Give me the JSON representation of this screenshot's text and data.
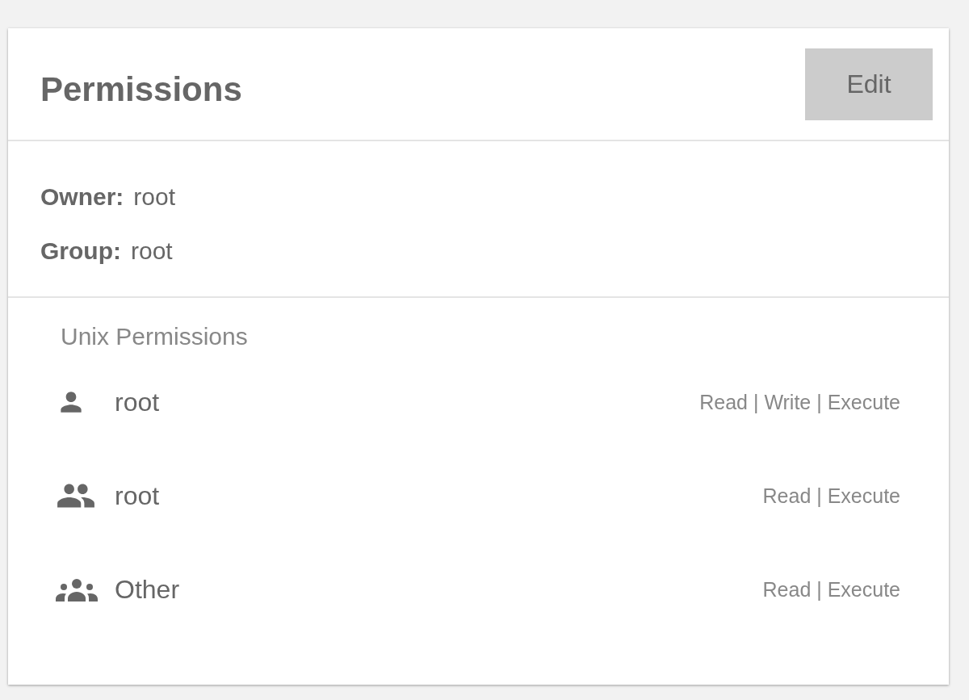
{
  "card": {
    "title": "Permissions",
    "edit_button": "Edit"
  },
  "ownership": [
    {
      "label": "Owner:",
      "value": "root"
    },
    {
      "label": "Group:",
      "value": "root"
    }
  ],
  "unix_permissions": {
    "heading": "Unix Permissions",
    "entries": [
      {
        "kind": "user",
        "name": "root",
        "permissions": "Read | Write | Execute"
      },
      {
        "kind": "group",
        "name": "root",
        "permissions": "Read | Execute"
      },
      {
        "kind": "other",
        "name": "Other",
        "permissions": "Read | Execute"
      }
    ]
  }
}
